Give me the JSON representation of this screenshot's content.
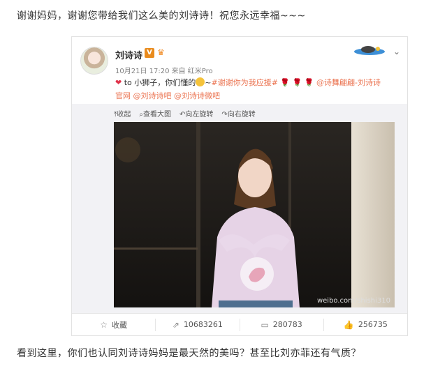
{
  "intro_text": "谢谢妈妈，谢谢您带给我们这么美的刘诗诗！祝您永远幸福~~~",
  "outro_text": "看到这里，你们也认同刘诗诗妈妈是最天然的美吗？甚至比刘亦菲还有气质？",
  "post": {
    "author": "刘诗诗",
    "verified_badge": "V",
    "timeline": "10月21日 17:20 来自 红米Pro",
    "text_prefix": "to 小狮子，你们懂的",
    "hashtag": "#谢谢你为我应援#",
    "mention_1": "@诗舞翩翩-刘诗诗",
    "mention_1b": "官网",
    "mention_2": "@刘诗诗吧",
    "mention_3": "@刘诗诗微吧"
  },
  "media_tools": {
    "collapse": "收起",
    "view_large": "查看大图",
    "rotate_left": "向左旋转",
    "rotate_right": "向右旋转"
  },
  "watermark": "weibo.com/shishi310",
  "actions": {
    "favorite": "收藏",
    "repost": "10683261",
    "comment": "280783",
    "like": "256735"
  },
  "colors": {
    "link": "#eb7350",
    "verified": "#e98b1d"
  }
}
